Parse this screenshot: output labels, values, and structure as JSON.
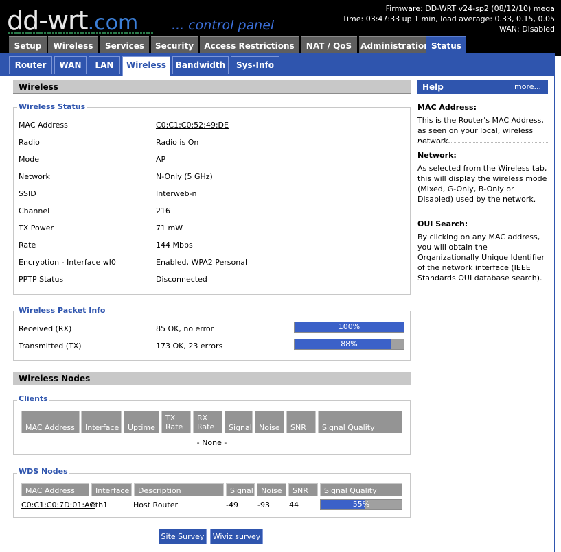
{
  "header": {
    "logo_main": "dd-wrt",
    "logo_dot": ".com",
    "logo_sub": "... control panel",
    "firmware": "Firmware: DD-WRT v24-sp2 (08/12/10) mega",
    "time": "Time: 03:47:33 up 1 min, load average: 0.33, 0.15, 0.05",
    "wan": "WAN: Disabled"
  },
  "main_tabs": [
    "Setup",
    "Wireless",
    "Services",
    "Security",
    "Access Restrictions",
    "NAT / QoS",
    "Administration",
    "Status"
  ],
  "active_main_tab": "Status",
  "sub_tabs": [
    "Router",
    "WAN",
    "LAN",
    "Wireless",
    "Bandwidth",
    "Sys-Info"
  ],
  "active_sub_tab": "Wireless",
  "wireless": {
    "section_title": "Wireless",
    "status_legend": "Wireless Status",
    "status_rows": [
      {
        "label": "MAC Address",
        "value": "C0:C1:C0:52:49:DE"
      },
      {
        "label": "Radio",
        "value": "Radio is On"
      },
      {
        "label": "Mode",
        "value": "AP"
      },
      {
        "label": "Network",
        "value": "N-Only (5 GHz)"
      },
      {
        "label": "SSID",
        "value": "Interweb-n"
      },
      {
        "label": "Channel",
        "value": "216"
      },
      {
        "label": "TX Power",
        "value": "71 mW"
      },
      {
        "label": "Rate",
        "value": "144 Mbps"
      },
      {
        "label": "Encryption - Interface wl0",
        "value": "Enabled, WPA2 Personal"
      },
      {
        "label": "PPTP Status",
        "value": "Disconnected"
      }
    ],
    "packet_legend": "Wireless Packet Info",
    "packet_rows": [
      {
        "label": "Received (RX)",
        "value": "85 OK, no error",
        "percent": 100,
        "percent_label": "100%"
      },
      {
        "label": "Transmitted (TX)",
        "value": "173 OK, 23 errors",
        "percent": 88,
        "percent_label": "88%"
      }
    ]
  },
  "nodes": {
    "section_title": "Wireless Nodes",
    "clients_legend": "Clients",
    "clients_headers": [
      "MAC Address",
      "Interface",
      "Uptime",
      "TX Rate",
      "RX Rate",
      "Signal",
      "Noise",
      "SNR",
      "Signal Quality"
    ],
    "clients_empty": "- None -",
    "wds_legend": "WDS Nodes",
    "wds_headers": [
      "MAC Address",
      "Interface",
      "Description",
      "Signal",
      "Noise",
      "SNR",
      "Signal Quality"
    ],
    "wds_rows": [
      {
        "mac": "C0:C1:C0:7D:01:AC",
        "interface": "eth1",
        "description": "Host Router",
        "signal": "-49",
        "noise": "-93",
        "snr": "44",
        "quality": 55,
        "quality_label": "55%"
      }
    ]
  },
  "buttons": {
    "site_survey": "Site Survey",
    "wiviz": "Wiviz survey"
  },
  "help": {
    "title": "Help",
    "more": "more...",
    "items": [
      {
        "title": "MAC Address:",
        "text": "This is the Router's MAC Address, as seen on your local, wireless network."
      },
      {
        "title": "Network:",
        "text": "As selected from the Wireless tab, this will display the wireless mode (Mixed, G-Only, B-Only or Disabled) used by the network."
      },
      {
        "title": "OUI Search:",
        "text": "By clicking on any MAC address, you will obtain the Organizationally Unique Identifier of the network interface (IEEE Standards OUI database search)."
      }
    ]
  },
  "colors": {
    "accent": "#2f55ae",
    "bar_fill": "#3b61c8",
    "header_bg": "#000000"
  }
}
